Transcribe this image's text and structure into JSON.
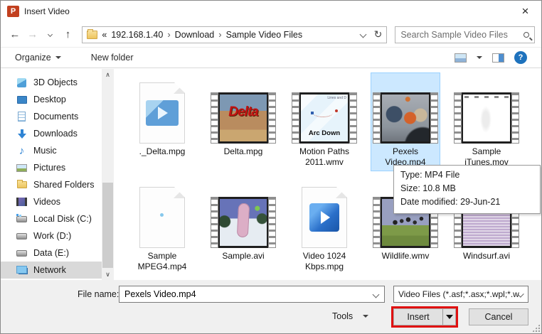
{
  "window": {
    "title": "Insert Video",
    "close_glyph": "×"
  },
  "nav": {
    "back_glyph": "←",
    "forward_glyph": "→",
    "up_glyph": "↑",
    "refresh_glyph": "↻",
    "address": {
      "prefix": "«",
      "crumbs": [
        "192.168.1.40",
        "Download",
        "Sample Video Files"
      ],
      "separator": "›"
    },
    "search": {
      "placeholder": "Search Sample Video Files"
    }
  },
  "toolbar": {
    "organize_label": "Organize",
    "new_folder_label": "New folder",
    "help_glyph": "?"
  },
  "sidebar": {
    "scroll_up_glyph": "∧",
    "scroll_down_glyph": "∨",
    "music_glyph": "♪",
    "items": [
      {
        "label": "3D Objects"
      },
      {
        "label": "Desktop"
      },
      {
        "label": "Documents"
      },
      {
        "label": "Downloads"
      },
      {
        "label": "Music"
      },
      {
        "label": "Pictures"
      },
      {
        "label": "Shared Folders"
      },
      {
        "label": "Videos"
      },
      {
        "label": "Local Disk (C:)"
      },
      {
        "label": "Work (D:)"
      },
      {
        "label": "Data (E:)"
      },
      {
        "label": "Network"
      }
    ]
  },
  "files": {
    "items": [
      {
        "label1": "._Delta.mpg"
      },
      {
        "label1": "Delta.mpg",
        "thumb_text": "Delta"
      },
      {
        "label1": "Motion Paths",
        "label2": "2011.wmv",
        "thumb_text": "Arc Down",
        "thumb_corner_text": "Lines and D"
      },
      {
        "label1": "Pexels",
        "label2": "Video.mp4",
        "selected": true
      },
      {
        "label1": "Sample",
        "label2": "iTunes.mov"
      },
      {
        "label1": "Sample",
        "label2": "MPEG4.mp4"
      },
      {
        "label1": "Sample.avi"
      },
      {
        "label1": "Video 1024",
        "label2": "Kbps.mpg"
      },
      {
        "label1": "Wildlife.wmv"
      },
      {
        "label1": "Windsurf.avi"
      }
    ]
  },
  "tooltip": {
    "line1": "Type: MP4 File",
    "line2": "Size: 10.8 MB",
    "line3": "Date modified: 29-Jun-21"
  },
  "footer": {
    "file_name_label": "File name:",
    "file_name_value": "Pexels Video.mp4",
    "file_type_value": "Video Files (*.asf;*.asx;*.wpl;*.w",
    "tools_label": "Tools",
    "insert_label": "Insert",
    "cancel_label": "Cancel"
  },
  "colors": {
    "selection_bg": "#cce8ff",
    "selection_border": "#9ad1ff",
    "annotation_red": "#e01010",
    "help_blue": "#1e72bd",
    "accent": "#0078d7"
  }
}
